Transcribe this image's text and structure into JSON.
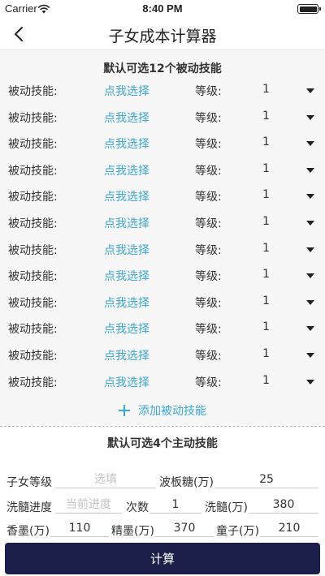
{
  "status_bar": {
    "carrier": "Carrier",
    "time": "8:40 PM"
  },
  "nav": {
    "title": "子女成本计算器",
    "back_icon": "chevron-left-icon"
  },
  "passive": {
    "section_title": "默认可选12个被动技能",
    "rows": [
      {
        "label": "被动技能:",
        "picker": "点我选择",
        "grade_label": "等级:",
        "grade_value": "1"
      },
      {
        "label": "被动技能:",
        "picker": "点我选择",
        "grade_label": "等级:",
        "grade_value": "1"
      },
      {
        "label": "被动技能:",
        "picker": "点我选择",
        "grade_label": "等级:",
        "grade_value": "1"
      },
      {
        "label": "被动技能:",
        "picker": "点我选择",
        "grade_label": "等级:",
        "grade_value": "1"
      },
      {
        "label": "被动技能:",
        "picker": "点我选择",
        "grade_label": "等级:",
        "grade_value": "1"
      },
      {
        "label": "被动技能:",
        "picker": "点我选择",
        "grade_label": "等级:",
        "grade_value": "1"
      },
      {
        "label": "被动技能:",
        "picker": "点我选择",
        "grade_label": "等级:",
        "grade_value": "1"
      },
      {
        "label": "被动技能:",
        "picker": "点我选择",
        "grade_label": "等级:",
        "grade_value": "1"
      },
      {
        "label": "被动技能:",
        "picker": "点我选择",
        "grade_label": "等级:",
        "grade_value": "1"
      },
      {
        "label": "被动技能:",
        "picker": "点我选择",
        "grade_label": "等级:",
        "grade_value": "1"
      },
      {
        "label": "被动技能:",
        "picker": "点我选择",
        "grade_label": "等级:",
        "grade_value": "1"
      },
      {
        "label": "被动技能:",
        "picker": "点我选择",
        "grade_label": "等级:",
        "grade_value": "1"
      }
    ],
    "add_label": "添加被动技能"
  },
  "active": {
    "section_title": "默认可选4个主动技能"
  },
  "form": {
    "child_level_label": "子女等级",
    "child_level_placeholder": "选填",
    "boban_label": "波板糖(万)",
    "boban_value": "25",
    "xisui_progress_label": "洗髓进度",
    "xisui_progress_placeholder": "当前进度",
    "count_label": "次数",
    "count_value": "1",
    "xisui_wan_label": "洗髓(万)",
    "xisui_wan_value": "380",
    "xiangmo_label": "香墨(万)",
    "xiangmo_value": "110",
    "jingmo_label": "精墨(万)",
    "jingmo_value": "370",
    "tongzi_label": "童子(万)",
    "tongzi_value": "210"
  },
  "calculate_label": "计算",
  "colors": {
    "link_blue": "#3ba6d8",
    "button_navy": "#1c1f4a",
    "section_bg": "#f7f7f7"
  }
}
